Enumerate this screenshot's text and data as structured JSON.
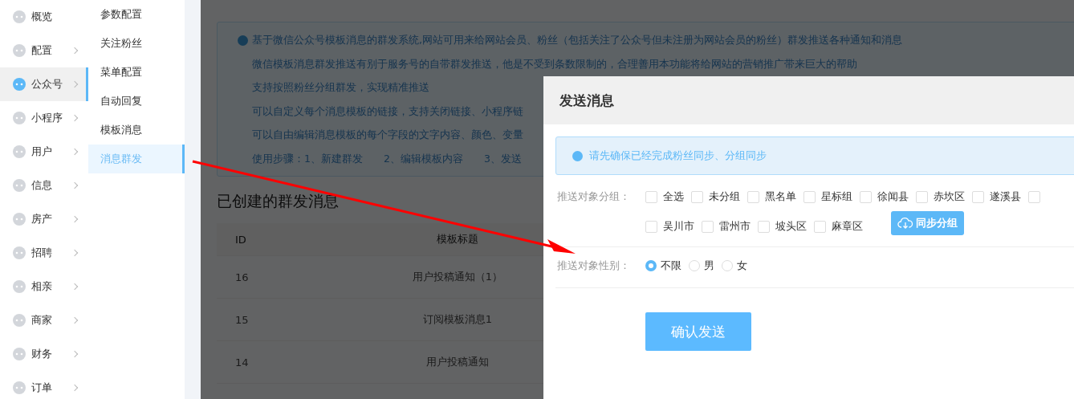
{
  "main_menu": [
    {
      "label": "概览",
      "has_submenu": false,
      "selected": false
    },
    {
      "label": "配置",
      "has_submenu": true,
      "selected": false
    },
    {
      "label": "公众号",
      "has_submenu": true,
      "selected": true
    },
    {
      "label": "小程序",
      "has_submenu": true,
      "selected": false
    },
    {
      "label": "用户",
      "has_submenu": true,
      "selected": false
    },
    {
      "label": "信息",
      "has_submenu": true,
      "selected": false
    },
    {
      "label": "房产",
      "has_submenu": true,
      "selected": false
    },
    {
      "label": "招聘",
      "has_submenu": true,
      "selected": false
    },
    {
      "label": "相亲",
      "has_submenu": true,
      "selected": false
    },
    {
      "label": "商家",
      "has_submenu": true,
      "selected": false
    },
    {
      "label": "财务",
      "has_submenu": true,
      "selected": false
    },
    {
      "label": "订单",
      "has_submenu": true,
      "selected": false
    }
  ],
  "sub_menu": [
    {
      "label": "参数配置",
      "selected": false
    },
    {
      "label": "关注粉丝",
      "selected": false
    },
    {
      "label": "菜单配置",
      "selected": false
    },
    {
      "label": "自动回复",
      "selected": false
    },
    {
      "label": "模板消息",
      "selected": false
    },
    {
      "label": "消息群发",
      "selected": true
    }
  ],
  "notice": {
    "lines": [
      "基于微信公众号模板消息的群发系统,网站可用来给网站会员、粉丝（包括关注了公众号但未注册为网站会员的粉丝）群发推送各种通知和消息",
      "微信模板消息群发推送有别于服务号的自带群发推送，他是不受到条数限制的，合理善用本功能将给网站的营销推广带来巨大的帮助",
      "支持按照粉丝分组群发，实现精准推送",
      "可以自定义每个消息模板的链接，支持关闭链接、小程序链",
      "可以自由编辑消息模板的每个字段的文字内容、颜色、变量",
      "使用步骤：1、新建群发　　2、编辑模板内容　　3、发送"
    ]
  },
  "section_title": "已创建的群发消息",
  "table": {
    "columns": [
      "ID",
      "模板标题"
    ],
    "rows": [
      [
        "16",
        "用户投稿通知（1）"
      ],
      [
        "15",
        "订阅模板消息1"
      ],
      [
        "14",
        "用户投稿通知"
      ]
    ]
  },
  "dialog": {
    "title": "发送消息",
    "alert": "请先确保已经完成粉丝同步、分组同步",
    "group_label": "推送对象分组：",
    "group_rows": [
      [
        {
          "label": "全选",
          "checked": false
        },
        {
          "label": "未分组",
          "checked": false
        },
        {
          "label": "黑名单",
          "checked": false
        },
        {
          "label": "星标组",
          "checked": false
        },
        {
          "label": "徐闻县",
          "checked": false
        },
        {
          "label": "赤坎区",
          "checked": false
        },
        {
          "label": "遂溪县",
          "checked": false
        },
        {
          "checked": false
        }
      ],
      [
        {
          "label": "吴川市",
          "checked": false
        },
        {
          "label": "雷州市",
          "checked": false
        },
        {
          "label": "坡头区",
          "checked": false
        },
        {
          "label": "麻章区",
          "checked": false
        }
      ]
    ],
    "sync_button": "同步分组",
    "gender_label": "推送对象性别：",
    "genders": [
      {
        "label": "不限",
        "selected": true
      },
      {
        "label": "男",
        "selected": false
      },
      {
        "label": "女",
        "selected": false
      }
    ],
    "submit_button": "确认发送"
  }
}
